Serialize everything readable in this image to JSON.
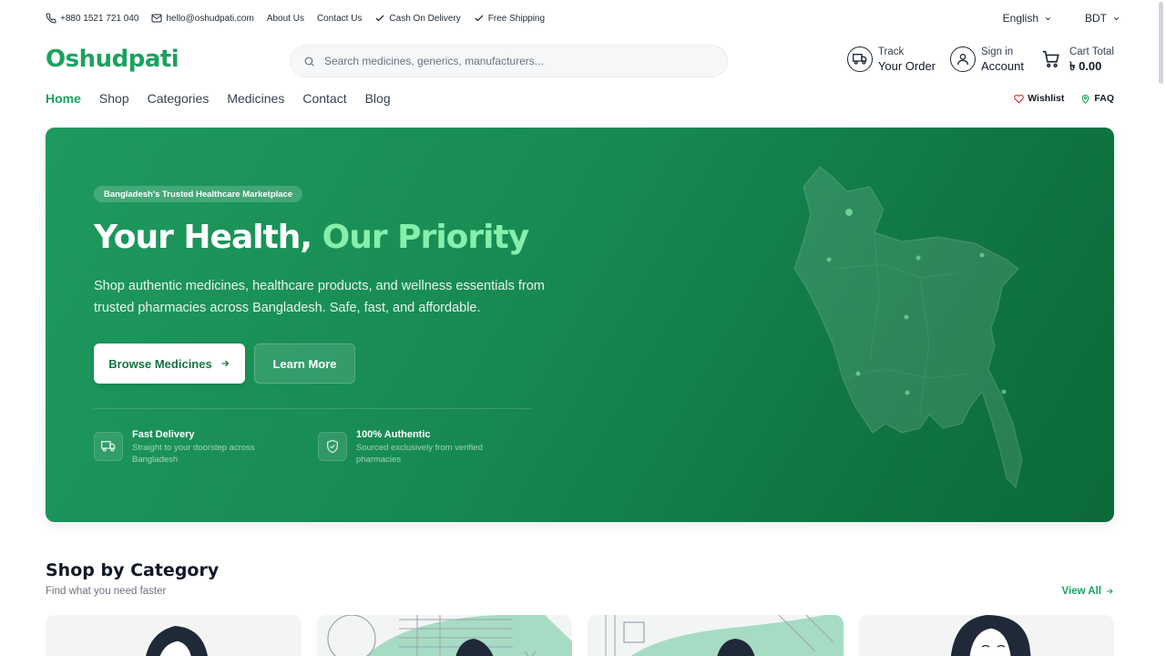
{
  "topbar": {
    "phone": "+880 1521 721 040",
    "email": "hello@oshudpati.com",
    "about": "About Us",
    "contact": "Contact Us",
    "cod": "Cash On Delivery",
    "shipping": "Free Shipping",
    "language": "English",
    "currency": "BDT"
  },
  "header": {
    "logo": "Oshudpati",
    "search_placeholder": "Search medicines, generics, manufacturers...",
    "track_line1": "Track",
    "track_line2": "Your Order",
    "account_line1": "Sign in",
    "account_line2": "Account",
    "cart_line1": "Cart Total",
    "cart_total": "৳ 0.00"
  },
  "nav": {
    "items": [
      "Home",
      "Shop",
      "Categories",
      "Medicines",
      "Contact",
      "Blog"
    ],
    "wishlist": "Wishlist",
    "faq": "FAQ"
  },
  "hero": {
    "badge": "Bangladesh's Trusted Healthcare Marketplace",
    "title_part1": "Your Health,",
    "title_part2": "Our Priority",
    "description": "Shop authentic medicines, healthcare products, and wellness essentials from trusted pharmacies across Bangladesh. Safe, fast, and affordable.",
    "btn_primary": "Browse Medicines",
    "btn_secondary": "Learn More",
    "features": [
      {
        "title": "Fast Delivery",
        "desc": "Straight to your doorstep across Bangladesh",
        "icon": "truck-icon"
      },
      {
        "title": "100% Authentic",
        "desc": "Sourced exclusively from verified pharmacies",
        "icon": "shield-check-icon"
      }
    ]
  },
  "categories": {
    "title": "Shop by Category",
    "subtitle": "Find what you need faster",
    "view_all": "View All"
  },
  "colors": {
    "brand": "#1aa260",
    "hero_start": "#1e9a5e",
    "hero_end": "#0b6a38",
    "highlight": "#86efac"
  }
}
